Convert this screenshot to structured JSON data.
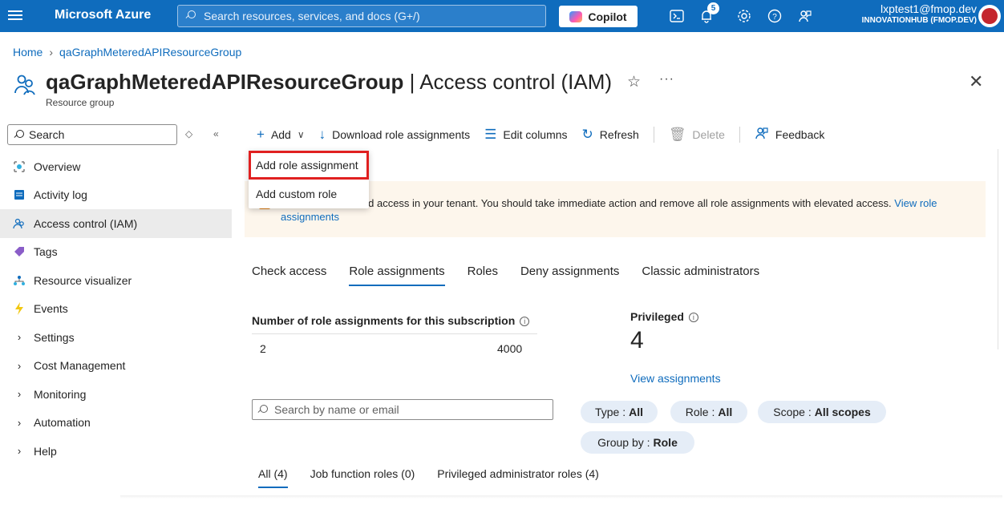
{
  "topbar": {
    "brand": "Microsoft Azure",
    "search_placeholder": "Search resources, services, and docs (G+/)",
    "copilot_label": "Copilot",
    "notification_count": "5",
    "user_email": "lxptest1@fmop.dev",
    "user_tenant": "INNOVATIONHUB (FMOP.DEV)",
    "accent_color": "#0f6cbd"
  },
  "breadcrumb": {
    "home": "Home",
    "current": "qaGraphMeteredAPIResourceGroup"
  },
  "header": {
    "resource_name": "qaGraphMeteredAPIResourceGroup",
    "separator": " | ",
    "blade_name": "Access control (IAM)",
    "subtitle": "Resource group"
  },
  "sidebar": {
    "search_placeholder": "Search",
    "items": [
      {
        "label": "Overview",
        "icon": "overview-icon"
      },
      {
        "label": "Activity log",
        "icon": "activity-log-icon"
      },
      {
        "label": "Access control (IAM)",
        "icon": "iam-icon",
        "active": true
      },
      {
        "label": "Tags",
        "icon": "tag-icon"
      },
      {
        "label": "Resource visualizer",
        "icon": "visualizer-icon"
      },
      {
        "label": "Events",
        "icon": "events-icon"
      },
      {
        "label": "Settings",
        "icon": "chevron-right-icon"
      },
      {
        "label": "Cost Management",
        "icon": "chevron-right-icon"
      },
      {
        "label": "Monitoring",
        "icon": "chevron-right-icon"
      },
      {
        "label": "Automation",
        "icon": "chevron-right-icon"
      },
      {
        "label": "Help",
        "icon": "chevron-right-icon"
      }
    ]
  },
  "toolbar": {
    "add": "Add",
    "download": "Download role assignments",
    "edit_columns": "Edit columns",
    "refresh": "Refresh",
    "delete": "Delete",
    "feedback": "Feedback"
  },
  "add_menu": {
    "add_role_assignment": "Add role assignment",
    "add_custom_role": "Add custom role"
  },
  "banner": {
    "text_visible": "users have elevated access in your tenant. You should take immediate action and remove all role assignments with elevated access.",
    "link": "View role assignments"
  },
  "tabs": [
    "Check access",
    "Role assignments",
    "Roles",
    "Deny assignments",
    "Classic administrators"
  ],
  "stats": {
    "count_label": "Number of role assignments for this subscription",
    "used": "2",
    "limit": "4000",
    "privileged_label": "Privileged",
    "privileged_value": "4",
    "view_link": "View assignments"
  },
  "filters": {
    "search_placeholder": "Search by name or email",
    "type_label": "Type : ",
    "type_value": "All",
    "role_label": "Role : ",
    "role_value": "All",
    "scope_label": "Scope : ",
    "scope_value": "All scopes",
    "groupby_label": "Group by : ",
    "groupby_value": "Role"
  },
  "subtabs": [
    "All (4)",
    "Job function roles (0)",
    "Privileged administrator roles (4)"
  ]
}
